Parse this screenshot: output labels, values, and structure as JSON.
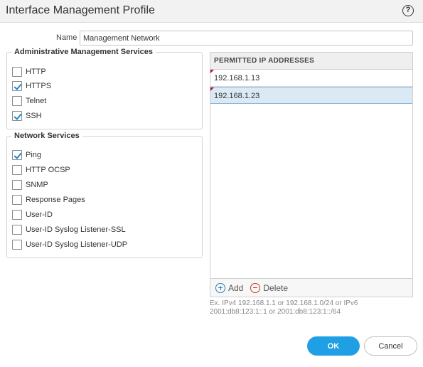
{
  "dialog": {
    "title": "Interface Management Profile",
    "help_icon": "help-icon",
    "help_glyph": "?"
  },
  "name_field": {
    "label": "Name",
    "value": "Management Network"
  },
  "admin_services": {
    "legend": "Administrative Management Services",
    "items": [
      {
        "label": "HTTP",
        "checked": false
      },
      {
        "label": "HTTPS",
        "checked": true
      },
      {
        "label": "Telnet",
        "checked": false
      },
      {
        "label": "SSH",
        "checked": true
      }
    ]
  },
  "network_services": {
    "legend": "Network Services",
    "items": [
      {
        "label": "Ping",
        "checked": true
      },
      {
        "label": "HTTP OCSP",
        "checked": false
      },
      {
        "label": "SNMP",
        "checked": false
      },
      {
        "label": "Response Pages",
        "checked": false
      },
      {
        "label": "User-ID",
        "checked": false
      },
      {
        "label": "User-ID Syslog Listener-SSL",
        "checked": false
      },
      {
        "label": "User-ID Syslog Listener-UDP",
        "checked": false
      }
    ]
  },
  "permitted_ips": {
    "header": "PERMITTED IP ADDRESSES",
    "rows": [
      {
        "value": "192.168.1.13",
        "selected": false
      },
      {
        "value": "192.168.1.23",
        "selected": true
      }
    ],
    "add_label": "Add",
    "delete_label": "Delete",
    "hint": "Ex. IPv4 192.168.1.1 or 192.168.1.0/24 or IPv6 2001:db8:123:1::1 or 2001:db8:123:1::/64"
  },
  "buttons": {
    "ok": "OK",
    "cancel": "Cancel"
  },
  "colors": {
    "accent": "#20a0e4",
    "check": "#1c86c8",
    "selected_row": "#dbe9f4",
    "delete": "#c0392b"
  }
}
